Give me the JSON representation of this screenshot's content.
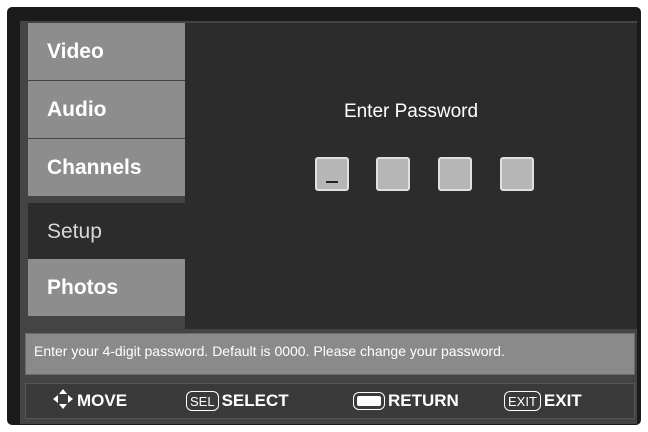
{
  "sidebar": {
    "items": [
      {
        "label": "Video"
      },
      {
        "label": "Audio"
      },
      {
        "label": "Channels"
      },
      {
        "label": "Setup"
      },
      {
        "label": "Photos"
      }
    ],
    "selected": "Setup"
  },
  "password": {
    "title": "Enter Password",
    "digits": [
      "_",
      "",
      "",
      ""
    ]
  },
  "hint": "Enter your 4-digit password. Default is 0000. Please change your password.",
  "nav": {
    "move": "MOVE",
    "sel_key": "SEL",
    "select": "SELECT",
    "return": "RETURN",
    "exit_key": "EXIT",
    "exit": "EXIT"
  },
  "icons": {
    "move": "four-way-arrow-icon",
    "return": "return-key-icon"
  },
  "colors": {
    "frame": "#1b1b1b",
    "sidebar_item": "#8d8d8d",
    "panel": "#2c2c2c",
    "password_box": "#b6b6b6",
    "hint_bar": "#8a8a8a"
  }
}
